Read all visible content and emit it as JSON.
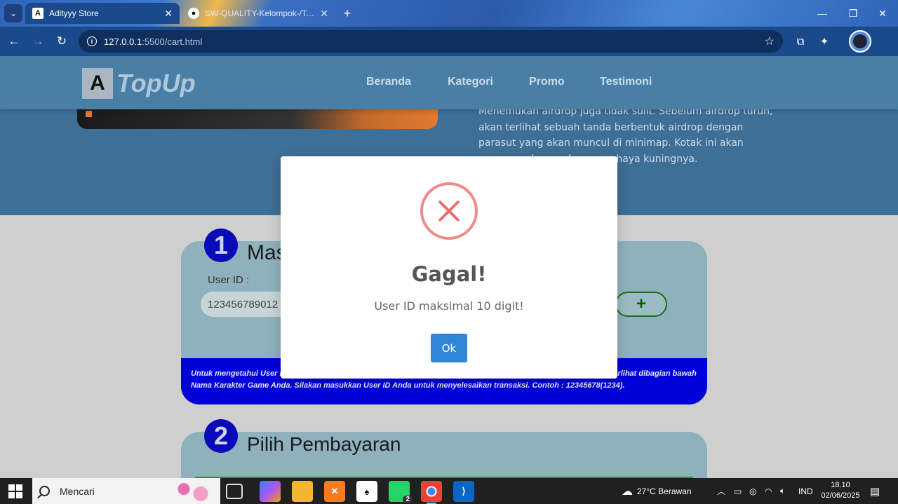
{
  "browser": {
    "tabs": [
      {
        "title": "Adityyy Store",
        "favicon": "A"
      },
      {
        "title": "SW-QUALITY-Kelompok-/Tests",
        "favicon": "github"
      }
    ],
    "new_tab": "+",
    "url_host": "127.0.0.1",
    "url_rest": ":5500/cart.html",
    "controls": {
      "minimize": "—",
      "maximize": "❐",
      "close": "✕"
    }
  },
  "site": {
    "logo_letter": "A",
    "logo_text": "TopUp",
    "nav": [
      "Beranda",
      "Kategori",
      "Promo",
      "Testimoni"
    ],
    "hero_text": "Menemukan airdrop juga tidak sulit. Sebelum airdrop turun, akan terlihat sebuah tanda berbentuk airdrop dengan parasut yang akan muncul di minimap. Kotak ini akan memancarkan ... dengan cahaya kuningnya."
  },
  "step1": {
    "number": "1",
    "title": "Mas",
    "user_id_label": "User ID :",
    "user_id_value": "123456789012",
    "add_button": "+",
    "hint": "Untuk mengetahui User ID Anda, silakan klik menu profile dibagian kiri atas pada menu utama game. User ID akan terlihat dibagian bawah Nama Karakter Game Anda. Silakan masukkan User ID Anda untuk menyelesaikan transaksi. Contoh : 12345678(1234)."
  },
  "step2": {
    "number": "2",
    "title": "Pilih Pembayaran"
  },
  "modal": {
    "icon": "error-x-icon",
    "title": "Gagal!",
    "message": "User ID maksimal 10 digit!",
    "ok_label": "Ok",
    "colors": {
      "icon": "#f27474",
      "button": "#3085d6"
    }
  },
  "taskbar": {
    "search_placeholder": "Mencari",
    "whatsapp_badge": "2",
    "weather": "27°C  Berawan",
    "language": "IND",
    "time": "18.10",
    "date": "02/06/2025"
  }
}
